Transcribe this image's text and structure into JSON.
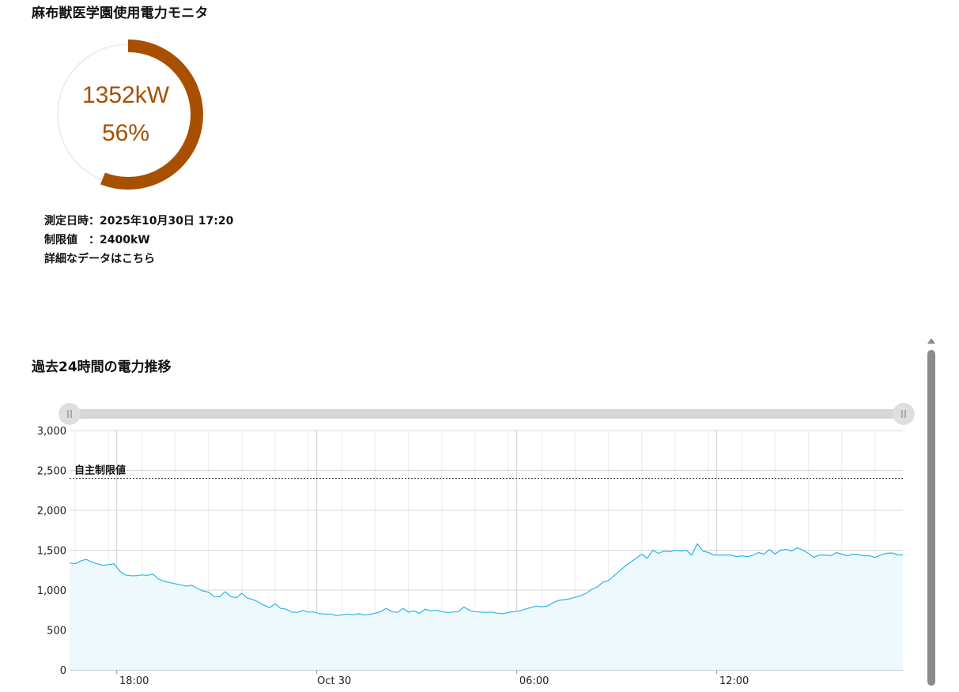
{
  "page": {
    "title": "麻布獣医学園使用電力モニタ"
  },
  "gauge": {
    "value_text": "1352kW",
    "percent_text": "56%",
    "fraction": 0.56,
    "arc_color": "#a84f00",
    "track_color": "#eeeeee"
  },
  "info": {
    "measured_at": "測定日時：2025年10月30日 17:20",
    "limit": "制限値　：2400kW",
    "detail_link": "詳細なデータはこちら"
  },
  "chart_section": {
    "title": "過去24時間の電力推移"
  },
  "chart_data": {
    "type": "area",
    "title": "",
    "xlabel": "",
    "ylabel": "",
    "ylim": [
      0,
      3000
    ],
    "y_ticks": [
      "0",
      "500",
      "1,000",
      "1,500",
      "2,000",
      "2,500",
      "3,000"
    ],
    "x_ticks": [
      {
        "label": "18:00",
        "t": 45
      },
      {
        "label": "Oct 30",
        "t": 405
      },
      {
        "label": "06:00",
        "t": 765
      },
      {
        "label": "12:00",
        "t": 1125
      }
    ],
    "x_range_minutes": [
      -40,
      1460
    ],
    "reference_line": {
      "label": "自主制限値",
      "value": 2400
    },
    "line_color": "#2bb5e8",
    "fill_color": "#eef9fd",
    "series": [
      {
        "x_minutes": [
          -40,
          -30,
          -20,
          -10,
          0,
          10,
          20,
          30,
          40,
          50,
          60,
          70,
          80,
          90,
          100,
          110,
          120,
          130,
          140,
          150,
          160,
          170,
          180,
          190,
          200,
          210,
          220,
          230,
          240,
          250,
          260,
          270,
          280,
          290,
          300,
          310,
          320,
          330,
          340,
          350,
          360,
          370,
          380,
          390,
          400,
          410,
          420,
          430,
          440,
          450,
          460,
          470,
          480,
          490,
          500,
          510,
          520,
          530,
          540,
          550,
          560,
          570,
          580,
          590,
          600,
          610,
          620,
          630,
          640,
          650,
          660,
          670,
          680,
          690,
          700,
          710,
          720,
          730,
          740,
          750,
          760,
          770,
          780,
          790,
          800,
          810,
          820,
          830,
          840,
          850,
          860,
          870,
          880,
          890,
          900,
          910,
          920,
          930,
          940,
          950,
          960,
          970,
          980,
          990,
          1000,
          1010,
          1020,
          1030,
          1040,
          1050,
          1060,
          1070,
          1080,
          1090,
          1100,
          1110,
          1120,
          1130,
          1140,
          1150,
          1160,
          1170,
          1180,
          1190,
          1200,
          1210,
          1220,
          1230,
          1240,
          1250,
          1260,
          1270,
          1280,
          1290,
          1300,
          1310,
          1320,
          1330,
          1340,
          1350,
          1360,
          1370,
          1380,
          1390,
          1400,
          1410,
          1420,
          1430,
          1440,
          1450,
          1460
        ],
        "values": [
          1340,
          1330,
          1365,
          1385,
          1350,
          1330,
          1310,
          1320,
          1330,
          1240,
          1190,
          1180,
          1180,
          1190,
          1185,
          1200,
          1140,
          1110,
          1095,
          1080,
          1065,
          1050,
          1060,
          1020,
          990,
          975,
          920,
          915,
          980,
          920,
          905,
          960,
          900,
          880,
          850,
          810,
          780,
          830,
          770,
          760,
          725,
          720,
          745,
          725,
          725,
          705,
          700,
          700,
          680,
          690,
          700,
          690,
          705,
          690,
          695,
          710,
          730,
          770,
          730,
          720,
          770,
          725,
          740,
          710,
          760,
          740,
          750,
          730,
          720,
          725,
          730,
          790,
          745,
          730,
          725,
          720,
          725,
          710,
          705,
          720,
          730,
          740,
          760,
          780,
          800,
          790,
          800,
          840,
          870,
          880,
          890,
          910,
          930,
          960,
          1010,
          1040,
          1100,
          1120,
          1180,
          1240,
          1300,
          1350,
          1400,
          1450,
          1400,
          1500,
          1460,
          1490,
          1480,
          1500,
          1490,
          1500,
          1440,
          1580,
          1490,
          1470,
          1440,
          1440,
          1440,
          1440,
          1420,
          1430,
          1420,
          1435,
          1470,
          1450,
          1510,
          1450,
          1500,
          1510,
          1490,
          1530,
          1500,
          1460,
          1410,
          1440,
          1440,
          1430,
          1470,
          1450,
          1430,
          1450,
          1445,
          1430,
          1430,
          1410,
          1440,
          1460,
          1465,
          1445,
          1440,
          1410,
          1350
        ]
      }
    ]
  }
}
